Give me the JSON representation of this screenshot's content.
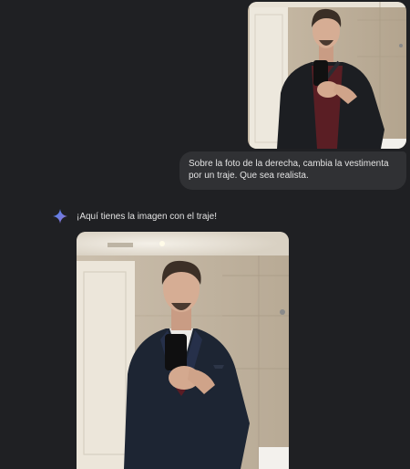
{
  "conversation": {
    "user_message": "Sobre la foto de la derecha, cambia la vestimenta por un traje. Que sea realista.",
    "assistant_reply": "¡Aquí tienes la imagen con el traje!"
  },
  "icons": {
    "assistant": "gemini-sparkle-icon"
  },
  "colors": {
    "background": "#1f2023",
    "user_bubble": "#303134",
    "text": "#e3e3e3",
    "sparkle_start": "#4285f4",
    "sparkle_end": "#9b72cb"
  }
}
